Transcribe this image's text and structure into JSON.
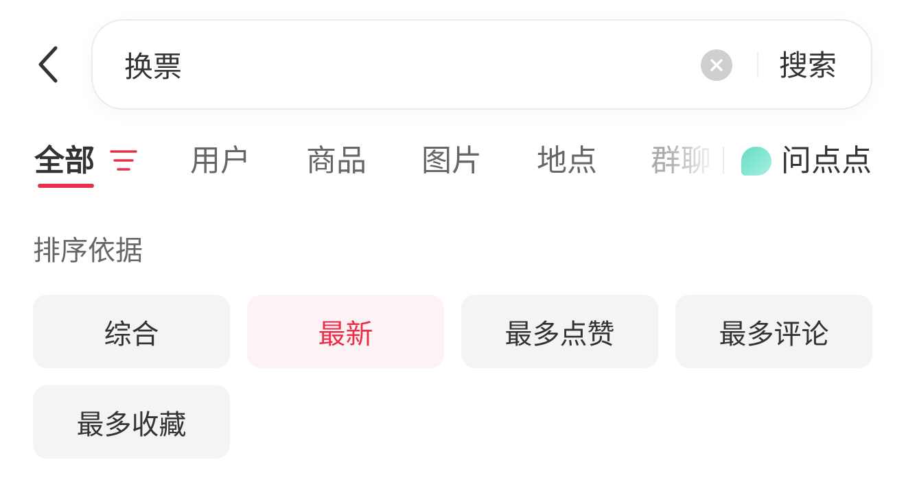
{
  "search": {
    "value": "换票",
    "submit_label": "搜索"
  },
  "tabs": [
    {
      "label": "全部",
      "active": true
    },
    {
      "label": "用户"
    },
    {
      "label": "商品"
    },
    {
      "label": "图片"
    },
    {
      "label": "地点"
    },
    {
      "label": "群聊"
    }
  ],
  "ask_tab": {
    "label": "问点点"
  },
  "sort": {
    "title": "排序依据",
    "options": [
      {
        "label": "综合"
      },
      {
        "label": "最新",
        "selected": true
      },
      {
        "label": "最多点赞"
      },
      {
        "label": "最多评论"
      },
      {
        "label": "最多收藏"
      }
    ]
  },
  "colors": {
    "accent": "#e8304a",
    "selected_chip_bg": "#fdf2f4",
    "chip_bg": "#f4f4f4",
    "ask_logo": "#66dcc6"
  },
  "icons": {
    "back": "chevron-left-icon",
    "clear": "clear-circle-icon",
    "filter": "filter-lines-icon",
    "ask_logo": "ask-logo-icon"
  }
}
